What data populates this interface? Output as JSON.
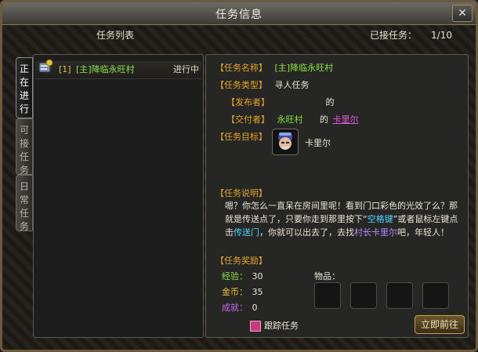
{
  "window": {
    "title": "任务信息",
    "close_label": "✕"
  },
  "header": {
    "list_title": "任务列表",
    "accepted_label": "已接任务：",
    "accepted_count": "1/10"
  },
  "tabs": [
    {
      "label": "正在进行",
      "chars": [
        "正",
        "在",
        "进",
        "行"
      ],
      "active": true
    },
    {
      "label": "可接任务",
      "chars": [
        "可",
        "接",
        "任",
        "务"
      ],
      "active": false
    },
    {
      "label": "日常任务",
      "chars": [
        "日",
        "常",
        "任",
        "务"
      ],
      "active": false
    }
  ],
  "quests": [
    {
      "index": "[1]",
      "name": "[主]降临永旺村",
      "state": "进行中"
    }
  ],
  "detail": {
    "name_label": "【任务名称】",
    "name": "[主]降临永旺村",
    "type_label": "【任务类型】",
    "type": "寻人任务",
    "publisher_label": "【发布者】",
    "publisher_suffix": "的",
    "deliver_label": "【交付者】",
    "deliver_place": "永旺村",
    "deliver_mid": "的",
    "deliver_npc": "卡里尔",
    "target_label": "【任务目标】",
    "target_npc": "卡里尔",
    "desc_label": "【任务说明】",
    "desc_part1": "嗯？你怎么一直呆在房间里呢！看到门口彩色的光效了么？那就是传送点了，只要你走到那里按下“",
    "desc_key": "空格键",
    "desc_part2": "”或者鼠标左键点击",
    "desc_portal": "传送门",
    "desc_part3": "，你就可以出去了，去找",
    "desc_npc": "村长卡里尔",
    "desc_part4": "吧，年轻人！",
    "reward_label": "【任务奖励】",
    "exp_label": "经验：",
    "exp_value": "30",
    "gold_label": "金币：",
    "gold_value": "35",
    "ach_label": "成就：",
    "ach_value": "0",
    "items_label": "物品：",
    "track_label": "跟踪任务",
    "goto_label": "立即前往"
  }
}
